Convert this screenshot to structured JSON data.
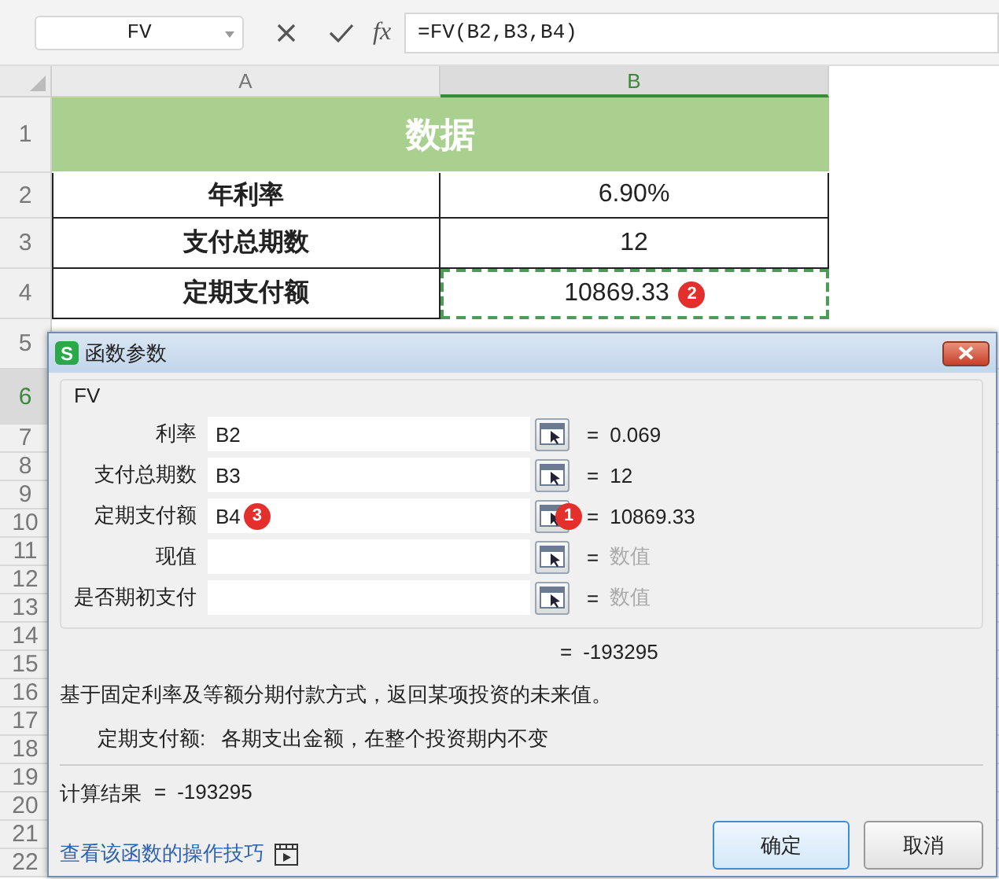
{
  "formula_bar": {
    "name_box": "FV",
    "fx_label": "fx",
    "formula": "=FV(B2,B3,B4)"
  },
  "columns": [
    {
      "label": "A",
      "selected": false
    },
    {
      "label": "B",
      "selected": true
    }
  ],
  "rows": [
    {
      "number": "1",
      "selected": false,
      "cells": [
        {
          "kind": "header",
          "text": "数据",
          "marquee": false
        }
      ]
    },
    {
      "number": "2",
      "selected": false,
      "cells": [
        {
          "kind": "label",
          "text": "年利率",
          "marquee": false
        },
        {
          "kind": "value",
          "text": "6.90%",
          "marquee": false
        }
      ]
    },
    {
      "number": "3",
      "selected": false,
      "cells": [
        {
          "kind": "label",
          "text": "支付总期数",
          "marquee": false
        },
        {
          "kind": "value",
          "text": "12",
          "marquee": false
        }
      ]
    },
    {
      "number": "4",
      "selected": false,
      "cells": [
        {
          "kind": "label",
          "text": "定期支付额",
          "marquee": false
        },
        {
          "kind": "value",
          "text": "10869.33",
          "marquee": true,
          "marker": "2"
        }
      ]
    },
    {
      "number": "5",
      "selected": false
    },
    {
      "number": "6",
      "selected": true
    },
    {
      "number": "7",
      "selected": false
    },
    {
      "number": "8",
      "selected": false
    },
    {
      "number": "9",
      "selected": false
    },
    {
      "number": "10",
      "selected": false
    },
    {
      "number": "11",
      "selected": false
    },
    {
      "number": "12",
      "selected": false
    },
    {
      "number": "13",
      "selected": false
    },
    {
      "number": "14",
      "selected": false
    },
    {
      "number": "15",
      "selected": false
    },
    {
      "number": "16",
      "selected": false
    },
    {
      "number": "17",
      "selected": false
    },
    {
      "number": "18",
      "selected": false
    },
    {
      "number": "19",
      "selected": false
    },
    {
      "number": "20",
      "selected": false
    },
    {
      "number": "21",
      "selected": false
    },
    {
      "number": "22",
      "selected": false
    }
  ],
  "dialog": {
    "app_badge": "S",
    "title": "函数参数",
    "function_name": "FV",
    "arguments": [
      {
        "label": "利率",
        "value": "B2",
        "result": "0.069"
      },
      {
        "label": "支付总期数",
        "value": "B3",
        "result": "12"
      },
      {
        "label": "定期支付额",
        "value": "B4",
        "value_marker": "3",
        "button_marker": "1",
        "result": "10869.33"
      },
      {
        "label": "现值",
        "hint": "数值"
      },
      {
        "label": "是否期初支付",
        "hint": "数值"
      }
    ],
    "equals": "=",
    "total": "-193295",
    "description": "基于固定利率及等额分期付款方式，返回某项投资的未来值。",
    "argument_help": {
      "label": "定期支付额:",
      "text": "各期支出金额，在整个投资期内不变"
    },
    "result_label": "计算结果",
    "result_equals": "=",
    "result_value": "-193295",
    "help_link": "查看该函数的操作技巧",
    "buttons": [
      {
        "label": "确定",
        "default": true
      },
      {
        "label": "取消",
        "default": false
      }
    ]
  }
}
